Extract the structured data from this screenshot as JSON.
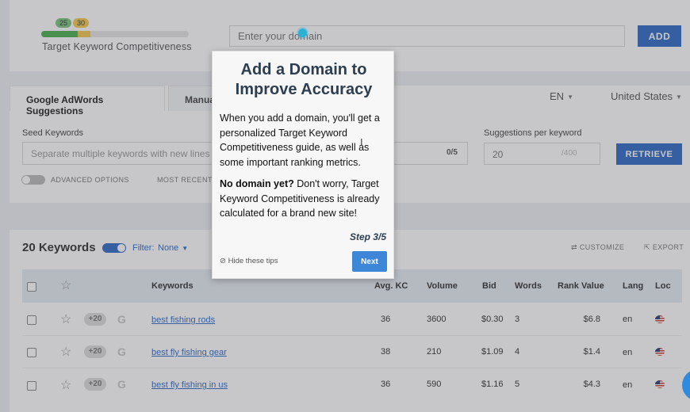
{
  "header": {
    "kc_badges": [
      "25",
      "30"
    ],
    "kc_label": "Target Keyword Competitiveness",
    "domain_placeholder": "Enter your domain",
    "add_label": "ADD"
  },
  "search": {
    "tabs": [
      "Google AdWords Suggestions",
      "Manua"
    ],
    "language": "EN",
    "country": "United States",
    "seed_label": "Seed Keywords",
    "seed_placeholder": "Separate multiple keywords with new lines",
    "seed_count": "0/5",
    "suggestions_label": "Suggestions per keyword",
    "suggestions_value": "20",
    "suggestions_max": "/400",
    "retrieve_label": "RETRIEVE",
    "advanced_label": "ADVANCED OPTIONS",
    "recent_label": "MOST RECENT S"
  },
  "results": {
    "count_label": "20 Keywords",
    "filter_label": "Filter:",
    "filter_value": "None",
    "customize_label": "CUSTOMIZE",
    "export_label": "EXPORT",
    "columns": [
      "Keywords",
      "Avg. KC",
      "Volume",
      "Bid",
      "Words",
      "Rank Value",
      "Lang",
      "Loc"
    ],
    "rows": [
      {
        "badge": "+20",
        "keyword": "best fishing rods",
        "kc": "36",
        "volume": "3600",
        "bid": "$0.30",
        "words": "3",
        "rank_value": "$6.8",
        "lang": "en"
      },
      {
        "badge": "+20",
        "keyword": "best fly fishing gear",
        "kc": "38",
        "volume": "210",
        "bid": "$1.09",
        "words": "4",
        "rank_value": "$1.4",
        "lang": "en"
      },
      {
        "badge": "+20",
        "keyword": "best fly fishing in us",
        "kc": "36",
        "volume": "590",
        "bid": "$1.16",
        "words": "5",
        "rank_value": "$4.3",
        "lang": "en"
      }
    ]
  },
  "tip": {
    "title": "Add a Domain to Improve Accuracy",
    "p1": "When you add a domain, you'll get a personalized Target Keyword Competitiveness guide, as well as some important ranking metrics.",
    "p2_bold": "No domain yet?",
    "p2_rest": " Don't worry, Target Keyword Competitiveness is already calculated for a brand new site!",
    "step": "Step 3/5",
    "hide": "Hide these tips",
    "next": "Next"
  }
}
